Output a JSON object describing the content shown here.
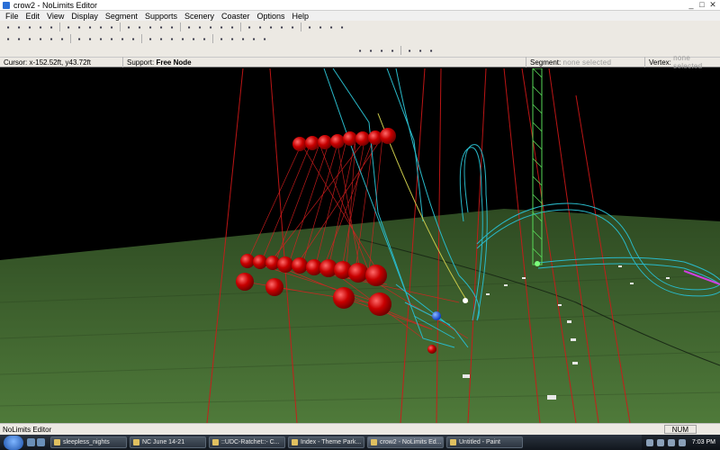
{
  "window": {
    "title": "crow2 - NoLimits Editor",
    "buttons": [
      "_",
      "□",
      "✕"
    ]
  },
  "menu": [
    "File",
    "Edit",
    "View",
    "Display",
    "Segment",
    "Supports",
    "Scenery",
    "Coaster",
    "Options",
    "Help"
  ],
  "toolbar1": [
    "new-file",
    "open-file",
    "save-file",
    "undo",
    "redo",
    "track-a",
    "track-b",
    "track-c",
    "track-d",
    "track-e",
    "track-f",
    "track-g",
    "track-h",
    "track-i",
    "track-j",
    "track-k",
    "track-l",
    "track-m",
    "track-n",
    "track-o",
    "track-p",
    "track-q",
    "track-r",
    "track-s",
    "track-t",
    "track-u",
    "track-v",
    "track-w",
    "track-x"
  ],
  "toolbar2": [
    "support-a",
    "support-b",
    "support-c",
    "support-d",
    "support-e",
    "support-f",
    "support-g",
    "support-h",
    "support-i",
    "support-j",
    "support-k",
    "support-l",
    "support-m",
    "support-n",
    "support-o",
    "support-p",
    "support-q",
    "support-r",
    "support-s",
    "support-t",
    "support-u",
    "support-v",
    "support-w"
  ],
  "toolbar3": [
    "select-tool",
    "vertex-tool",
    "add-vertex",
    "delete-vertex",
    "split-tool",
    "join-tool",
    "ring-tool"
  ],
  "status": {
    "cursor_label": "Cursor:",
    "cursor_value": "x-152.52ft, y43.72ft",
    "support_label": "Support:",
    "support_value": "Free Node",
    "segment_label": "Segment:",
    "segment_value": "none selected",
    "vertex_label": "Vertex:",
    "vertex_value": "none selected"
  },
  "editor_status": {
    "text": "NoLimits Editor",
    "num": "NUM"
  },
  "taskbar": {
    "tasks": [
      {
        "label": "sleepless_nights",
        "active": false
      },
      {
        "label": "NC June 14-21",
        "active": false
      },
      {
        "label": "::UDC-Ratchet::- C...",
        "active": false
      },
      {
        "label": "Index - Theme Park...",
        "active": false
      },
      {
        "label": "crow2 - NoLimits Ed...",
        "active": true
      },
      {
        "label": "Untitled - Paint",
        "active": false
      }
    ],
    "clock": "7:03 PM"
  }
}
